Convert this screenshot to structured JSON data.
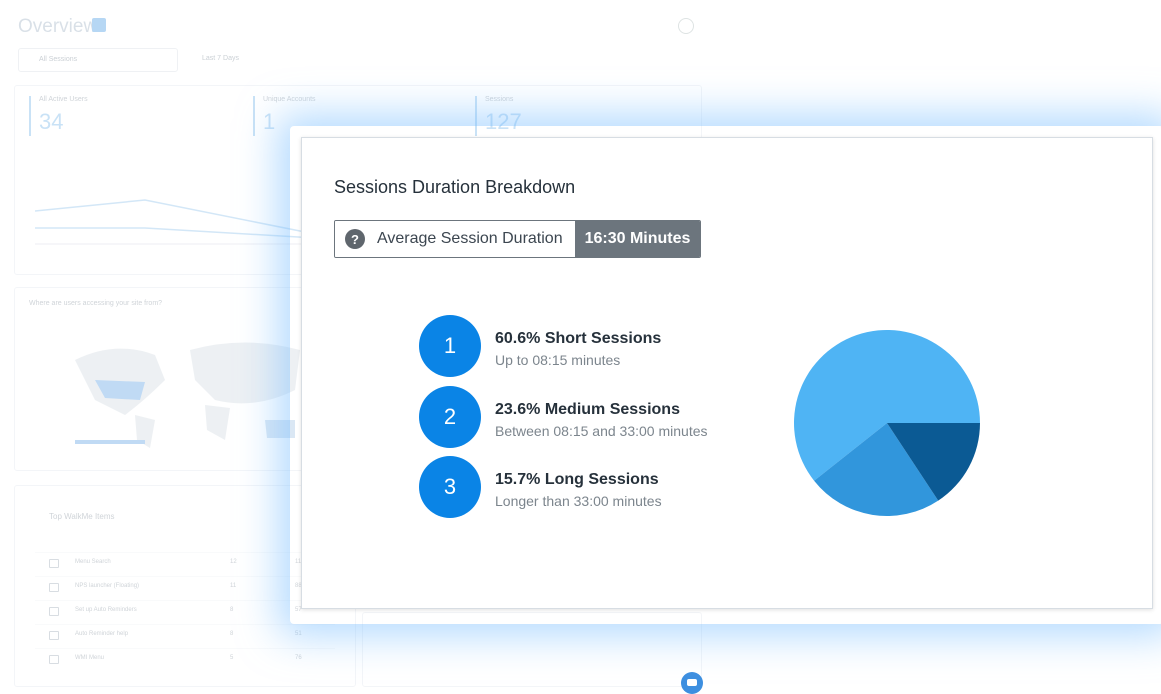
{
  "background": {
    "page_title": "Overview",
    "filter_segment": "All Sessions",
    "filter_date_label": "Last 7 Days",
    "stats": [
      {
        "label": "All Active Users",
        "value": "34"
      },
      {
        "label": "Unique Accounts",
        "value": "1"
      },
      {
        "label": "Sessions",
        "value": "127"
      }
    ],
    "map_heading": "Where are users accessing your site from?",
    "table_heading": "Top WalkMe Items",
    "table_rows": [
      {
        "name": "Menu Search",
        "v1": "12",
        "v2": "117"
      },
      {
        "name": "NPS launcher (Floating)",
        "v1": "11",
        "v2": "88"
      },
      {
        "name": "Set up Auto Reminders",
        "v1": "8",
        "v2": "57"
      },
      {
        "name": "Auto Reminder help",
        "v1": "8",
        "v2": "51"
      },
      {
        "name": "WMI Menu",
        "v1": "5",
        "v2": "76"
      }
    ]
  },
  "modal": {
    "title": "Sessions Duration Breakdown",
    "avg_label": "Average Session Duration",
    "avg_value": "16:30 Minutes",
    "help_icon": "?",
    "items": [
      {
        "number": "1",
        "heading": "60.6% Short Sessions",
        "description": "Up to 08:15 minutes"
      },
      {
        "number": "2",
        "heading": "23.6% Medium Sessions",
        "description": "Between 08:15 and 33:00 minutes"
      },
      {
        "number": "3",
        "heading": "15.7% Long Sessions",
        "description": "Longer than 33:00 minutes"
      }
    ]
  },
  "chart_data": {
    "type": "pie",
    "categories": [
      "Short Sessions",
      "Medium Sessions",
      "Long Sessions"
    ],
    "values": [
      60.6,
      23.6,
      15.7
    ],
    "colors": [
      "#4fb4f4",
      "#3196dc",
      "#0b5a94"
    ]
  },
  "colors": {
    "accent": "#0a84e6",
    "avg_value_bg": "#6c757d",
    "glow": "#78beff"
  }
}
